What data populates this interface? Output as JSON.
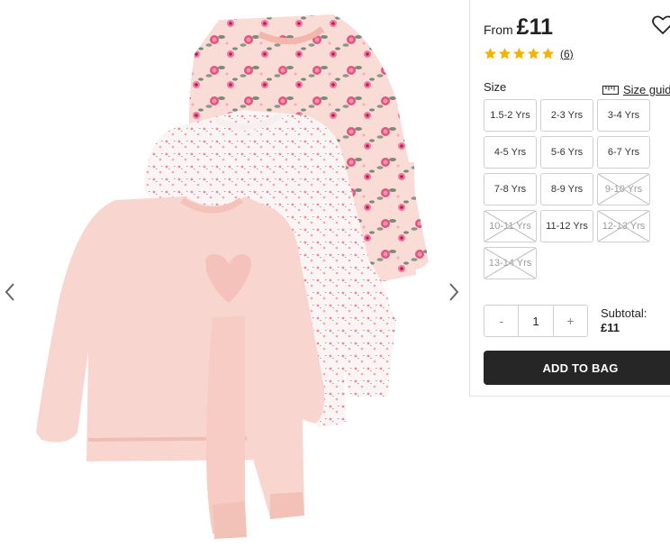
{
  "gallery": {
    "image_name": "pyjamas-multipack-image",
    "prev_icon": "chevron-left-icon",
    "next_icon": "chevron-right-icon"
  },
  "product": {
    "price_from_label": "From",
    "price": "£11",
    "wishlist_icon": "heart-outline-icon",
    "rating_stars": 5,
    "rating_count": "(6)"
  },
  "size": {
    "label": "Size",
    "guide_label": "Size guide",
    "options": [
      {
        "label": "1.5-2 Yrs",
        "available": true
      },
      {
        "label": "2-3 Yrs",
        "available": true
      },
      {
        "label": "3-4 Yrs",
        "available": true
      },
      {
        "label": "4-5 Yrs",
        "available": true
      },
      {
        "label": "5-6 Yrs",
        "available": true
      },
      {
        "label": "6-7 Yrs",
        "available": true
      },
      {
        "label": "7-8 Yrs",
        "available": true
      },
      {
        "label": "8-9 Yrs",
        "available": true
      },
      {
        "label": "9-10 Yrs",
        "available": false
      },
      {
        "label": "10-11 Yrs",
        "available": false
      },
      {
        "label": "11-12 Yrs",
        "available": true
      },
      {
        "label": "12-13 Yrs",
        "available": false
      },
      {
        "label": "13-14 Yrs",
        "available": false
      }
    ]
  },
  "quantity": {
    "minus": "-",
    "value": "1",
    "plus": "+"
  },
  "subtotal": {
    "label": "Subtotal:",
    "value": "£11"
  },
  "cart": {
    "add_label": "ADD TO BAG"
  },
  "colors": {
    "star": "#f5b400",
    "button_bg": "#262626",
    "pink": "#f6c9c2",
    "rose": "#e0567e"
  }
}
